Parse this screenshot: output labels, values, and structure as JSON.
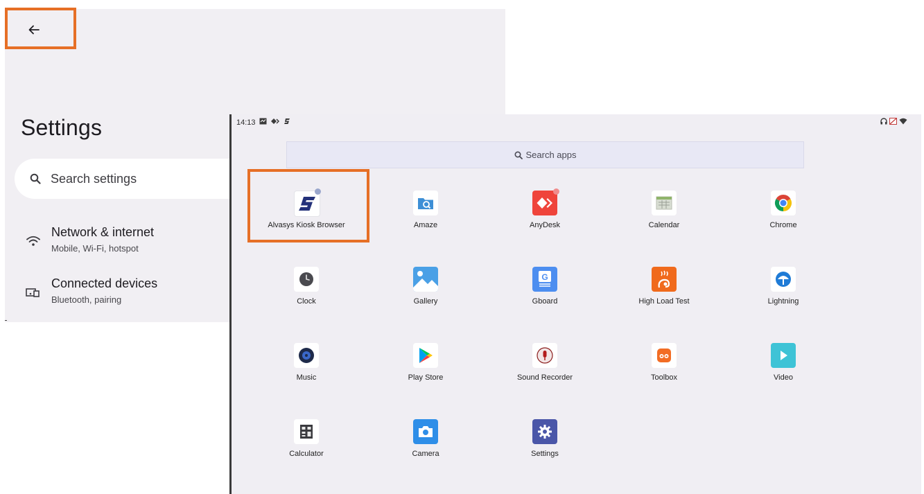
{
  "settings": {
    "title": "Settings",
    "search_placeholder": "Search settings",
    "items": [
      {
        "title": "Network & internet",
        "subtitle": "Mobile, Wi-Fi, hotspot",
        "icon": "wifi-icon"
      },
      {
        "title": "Connected devices",
        "subtitle": "Bluetooth, pairing",
        "icon": "devices-icon"
      }
    ]
  },
  "launcher": {
    "status_time": "14:13",
    "search_placeholder": "Search apps",
    "apps": [
      {
        "label": "Alvasys Kiosk Browser",
        "icon": "alvasys-kiosk-icon"
      },
      {
        "label": "Amaze",
        "icon": "amaze-folder-icon"
      },
      {
        "label": "AnyDesk",
        "icon": "anydesk-icon"
      },
      {
        "label": "Calendar",
        "icon": "calendar-icon"
      },
      {
        "label": "Chrome",
        "icon": "chrome-icon"
      },
      {
        "label": "Clock",
        "icon": "clock-icon"
      },
      {
        "label": "Gallery",
        "icon": "gallery-icon"
      },
      {
        "label": "Gboard",
        "icon": "gboard-icon"
      },
      {
        "label": "High Load Test",
        "icon": "high-load-test-icon"
      },
      {
        "label": "Lightning",
        "icon": "lightning-icon"
      },
      {
        "label": "Music",
        "icon": "music-icon"
      },
      {
        "label": "Play Store",
        "icon": "play-store-icon"
      },
      {
        "label": "Sound Recorder",
        "icon": "sound-recorder-icon"
      },
      {
        "label": "Toolbox",
        "icon": "toolbox-icon"
      },
      {
        "label": "Video",
        "icon": "video-icon"
      },
      {
        "label": "Calculator",
        "icon": "calculator-icon"
      },
      {
        "label": "Camera",
        "icon": "camera-icon"
      },
      {
        "label": "Settings",
        "icon": "settings-gear-icon"
      }
    ]
  },
  "colors": {
    "highlight": "#e66f26",
    "settings_bg": "#f1eff3",
    "launcher_bg": "#f0eef3",
    "notification_dot_blue": "#9aa6cc",
    "notification_dot_red": "#f08c8c"
  }
}
